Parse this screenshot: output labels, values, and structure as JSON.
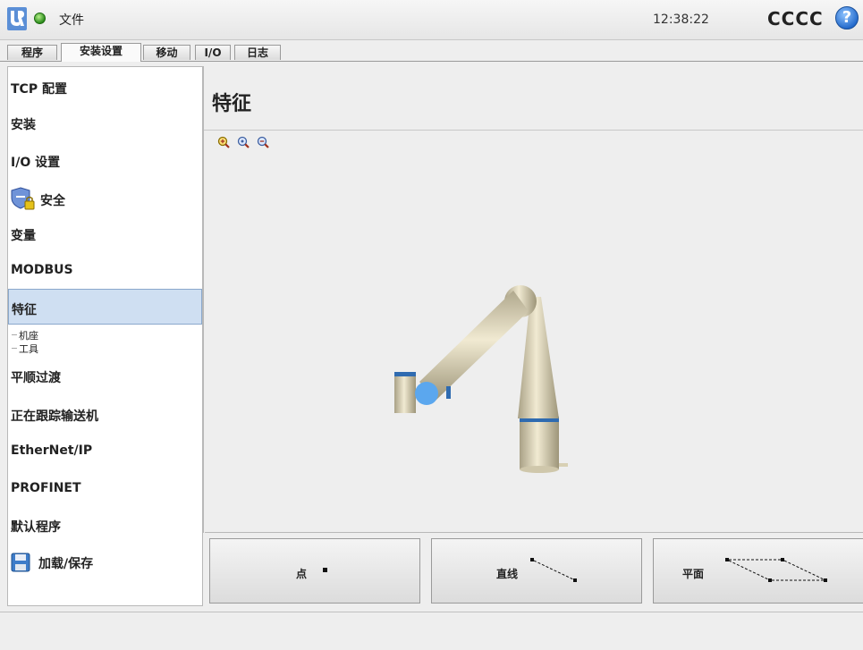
{
  "topbar": {
    "file_label": "文件",
    "clock": "12:38:22",
    "robot_name": "CCCC",
    "help_label": "?"
  },
  "tabs": [
    {
      "label": "程序",
      "active": false
    },
    {
      "label": "安装设置",
      "active": true
    },
    {
      "label": "移动",
      "active": false
    },
    {
      "label": "I/O",
      "active": false
    },
    {
      "label": "日志",
      "active": false
    }
  ],
  "sidebar": {
    "items": [
      {
        "label": "TCP 配置"
      },
      {
        "label": "安装"
      },
      {
        "label": "I/O 设置"
      },
      {
        "label": "安全",
        "icon": "shield-lock-icon"
      },
      {
        "label": "变量"
      },
      {
        "label": "MODBUS"
      },
      {
        "label": "特征",
        "active": true
      },
      {
        "label": "平顺过渡"
      },
      {
        "label": "正在跟踪输送机"
      },
      {
        "label": "EtherNet/IP"
      },
      {
        "label": "PROFINET"
      },
      {
        "label": "默认程序"
      },
      {
        "label": "加载/保存",
        "icon": "floppy-disk-icon"
      }
    ],
    "sub_items": [
      {
        "label": "机座"
      },
      {
        "label": "工具"
      }
    ]
  },
  "main": {
    "title": "特征"
  },
  "feature_buttons": [
    {
      "label": "点",
      "icon": "point-icon"
    },
    {
      "label": "直线",
      "icon": "line-icon"
    },
    {
      "label": "平面",
      "icon": "plane-icon"
    }
  ],
  "colors": {
    "accent_blue": "#5b9ee6",
    "selection": "#cfdff2",
    "robot_body": "#e6ddc0",
    "robot_joint_ring": "#2f6bb0"
  }
}
